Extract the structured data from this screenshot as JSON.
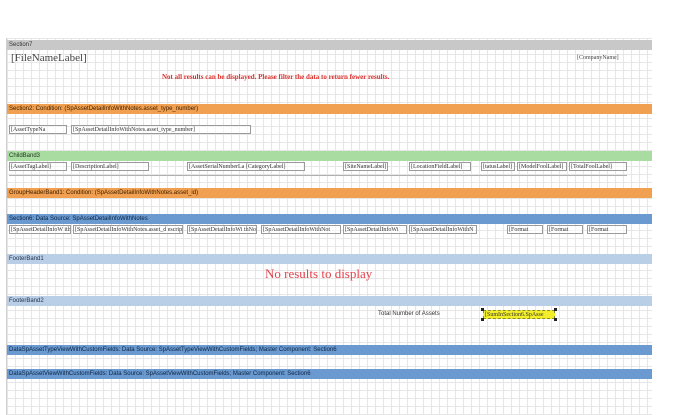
{
  "section7": {
    "band_label": "Section7",
    "file_name_label": "[FileNameLabel]",
    "company_name": "[CompanyName]",
    "warning": "Not all results can be displayed. Please filter the data to return fewer results."
  },
  "section2": {
    "band_label": "Section2: Condition: (SpAssetDetailInfoWithNotes.asset_type_number)",
    "asset_type_label": "[AssetTypeNa",
    "asset_type_field": "[SpAssetDetailInfoWithNotes.asset_type_number]"
  },
  "childband": {
    "band_label": "ChildBand3",
    "columns": [
      "[AssetTagLabel]",
      "[DescriptionLabel]",
      "[AssetSerialNumberLa  [CategoryLabel]",
      "[SiteNameLabel]",
      "[LocationFieldLabel]",
      "[tatusLabel]",
      "[ModelFoolLabel]",
      "[TotalFoolLabel]"
    ]
  },
  "group_header": {
    "band_label": "GroupHeaderBand1: Condition: (SpAssetDetailInfoWithNotes.asset_id)"
  },
  "section6": {
    "band_label": "Section6: Data Source: SpAssetDetailInfoWithNotes",
    "fields": [
      "[SpAssetDetailInfoW ithNotes.asset_tag]",
      "[SpAssetDetailInfoWithNotes.asset_d escription]",
      "[SpAssetDetailInfoWi thNotes.asset_se",
      "[SpAssetDetailInfoWithNot",
      "[SpAssetDetailInfoWi",
      "[SpAssetDetailInfoWithN",
      "[Format",
      "[Format",
      "[Format"
    ]
  },
  "footer1": {
    "band_label": "FooterBand1",
    "no_results": "No results to display"
  },
  "footer2": {
    "band_label": "FooterBand2",
    "total_label": "Total Number of Assets",
    "total_field": "[SumInSection6.SpAsse"
  },
  "data_bands": [
    "DataSpAssetTypeViewWithCustomFields: Data Source: SpAssetTypeViewWithCustomFields; Master Component: Section6",
    "DataSpAssetViewWithCustomFields: Data Source: SpAssetViewWithCustomFields; Master Component: Section6"
  ],
  "colors": {
    "gray_band": "#c8c8c8",
    "orange_band": "#f0a050",
    "green_band": "#a9dca0",
    "blue_band": "#6a9ad0",
    "light_blue_band": "#b9cfe8",
    "warning_text": "#d9302c",
    "highlight": "#f2ee2a"
  }
}
